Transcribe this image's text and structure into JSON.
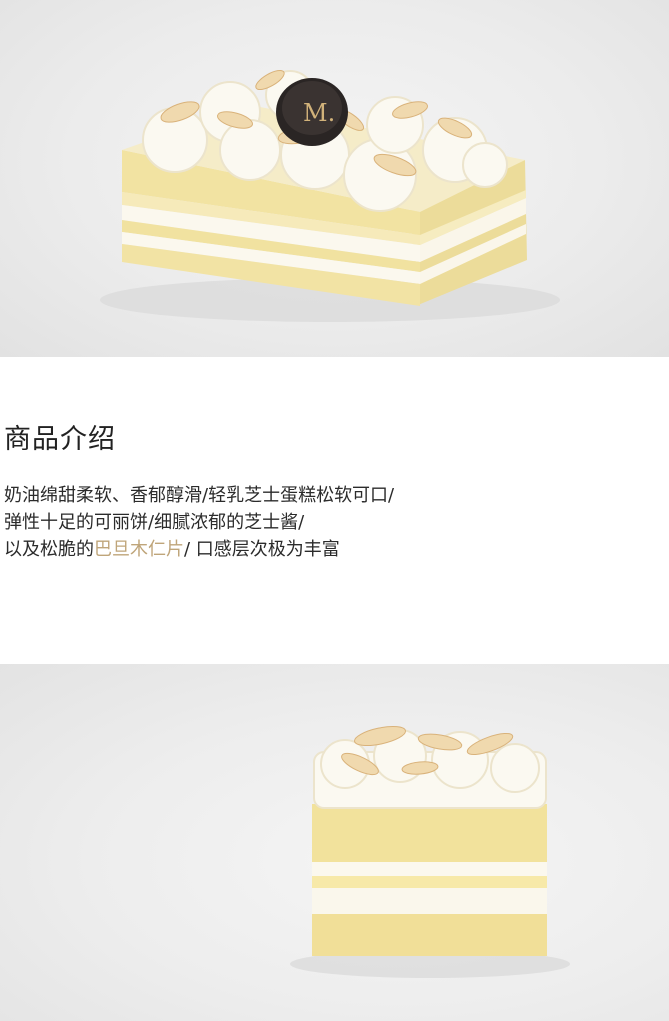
{
  "photos": {
    "top": {
      "logo_text": "M."
    }
  },
  "intro": {
    "title": "商品介绍",
    "line1": "奶油绵甜柔软、香郁醇滑/轻乳芝士蛋糕松软可口/",
    "line2": "弹性十足的可丽饼/细腻浓郁的芝士酱/",
    "line3_prefix": "以及松脆的",
    "line3_highlight": "巴旦木仁片",
    "line3_suffix": "/ 口感层次极为丰富"
  },
  "colors": {
    "highlight": "#bfa57a",
    "text": "#2b2b2b",
    "sponge": "#f3e6a8",
    "cream": "#fbf8ee"
  }
}
